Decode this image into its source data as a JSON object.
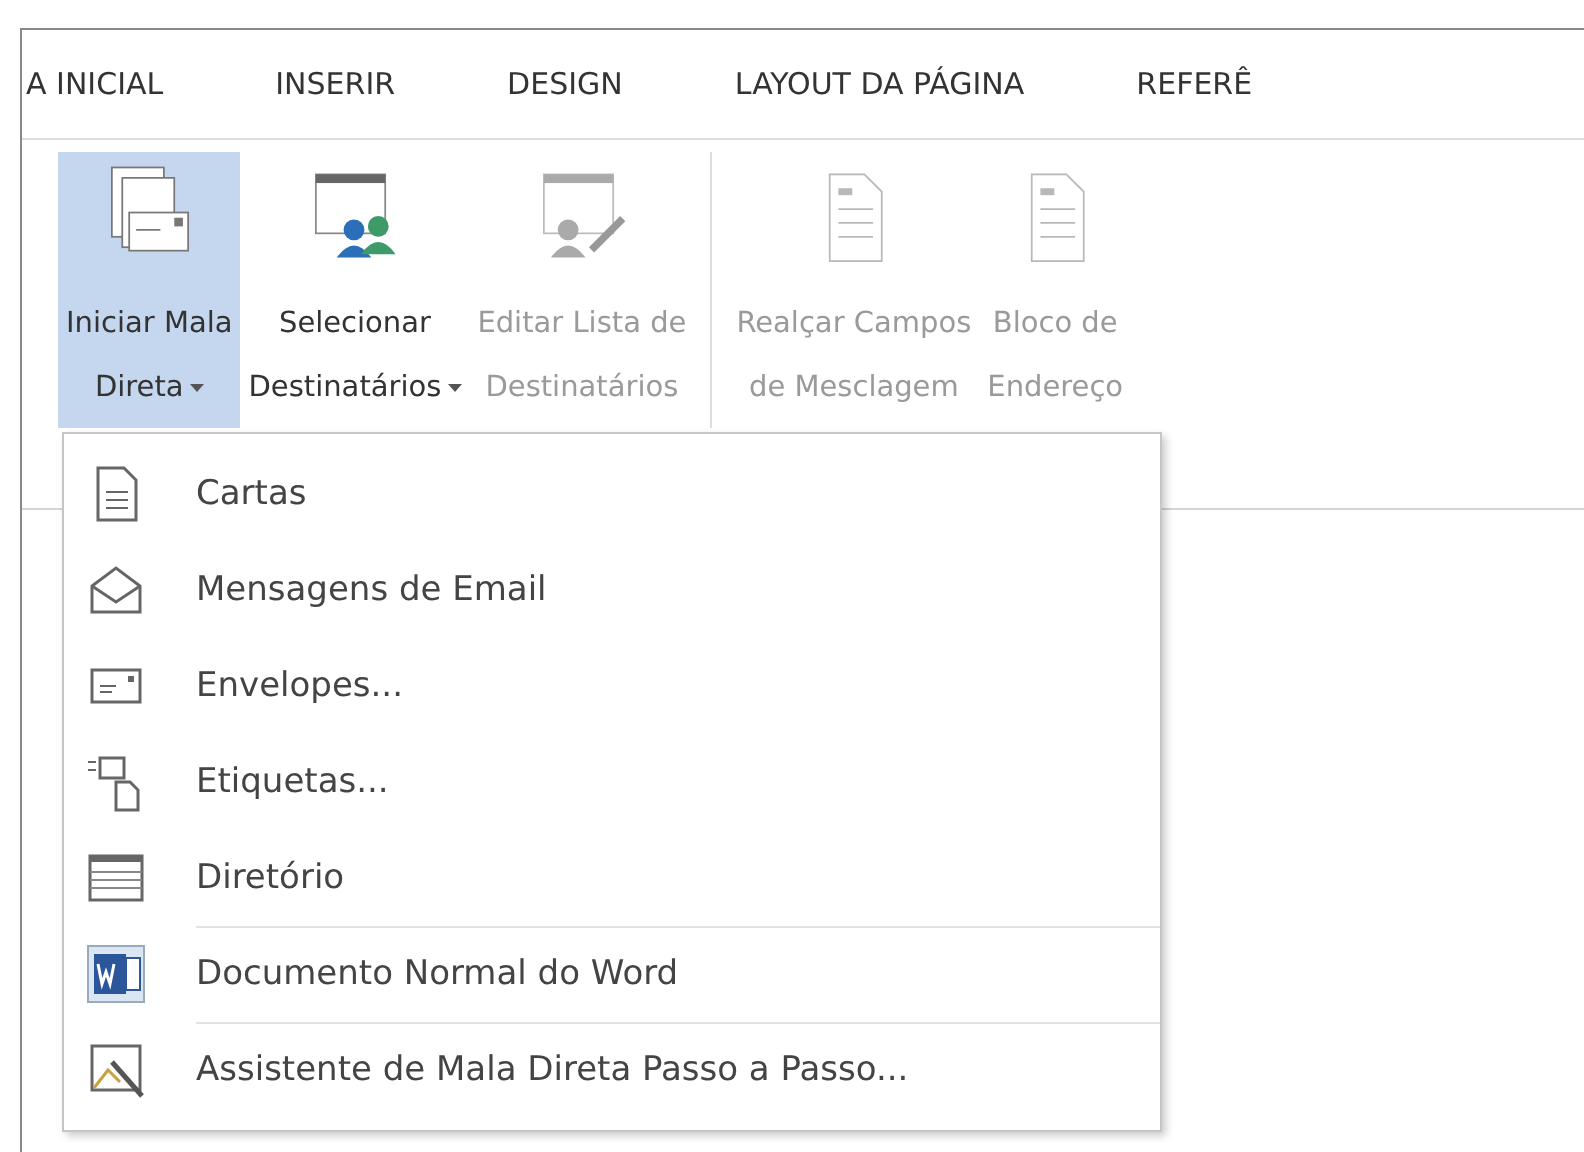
{
  "tabs": [
    {
      "label": "A INICIAL",
      "selected": false
    },
    {
      "label": "INSERIR",
      "selected": false
    },
    {
      "label": "DESIGN",
      "selected": false
    },
    {
      "label": "LAYOUT DA PÁGINA",
      "selected": false
    },
    {
      "label": "REFERÊ",
      "selected": false
    }
  ],
  "ribbon": [
    {
      "kind": "start",
      "lines": [
        "Iniciar Mala",
        "Direta"
      ],
      "dropdown": true,
      "selected": true,
      "disabled": false,
      "group_end": false
    },
    {
      "kind": "recipients",
      "lines": [
        "Selecionar",
        "Destinatários"
      ],
      "dropdown": true,
      "selected": false,
      "disabled": false,
      "group_end": false
    },
    {
      "kind": "edit",
      "lines": [
        "Editar Lista de",
        "Destinatários"
      ],
      "dropdown": false,
      "selected": false,
      "disabled": true,
      "group_end": true
    },
    {
      "kind": "highlight",
      "lines": [
        "Realçar Campos",
        "de Mesclagem"
      ],
      "dropdown": false,
      "selected": false,
      "disabled": true,
      "group_end": false
    },
    {
      "kind": "address",
      "lines": [
        "Bloco de",
        "Endereço"
      ],
      "dropdown": false,
      "selected": false,
      "disabled": true,
      "group_end": false
    }
  ],
  "menu": [
    {
      "kind": "letter",
      "label": "Cartas",
      "separator": false
    },
    {
      "kind": "email",
      "label": "Mensagens de Email",
      "separator": false
    },
    {
      "kind": "envelope",
      "label": "Envelopes...",
      "separator": false
    },
    {
      "kind": "labels",
      "label": "Etiquetas...",
      "separator": false
    },
    {
      "kind": "directory",
      "label": "Diretório",
      "separator": false
    },
    {
      "kind": "word",
      "label": "Documento Normal do Word",
      "separator": true
    },
    {
      "kind": "wizard",
      "label": "Assistente de Mala Direta Passo a Passo...",
      "separator": true
    }
  ]
}
